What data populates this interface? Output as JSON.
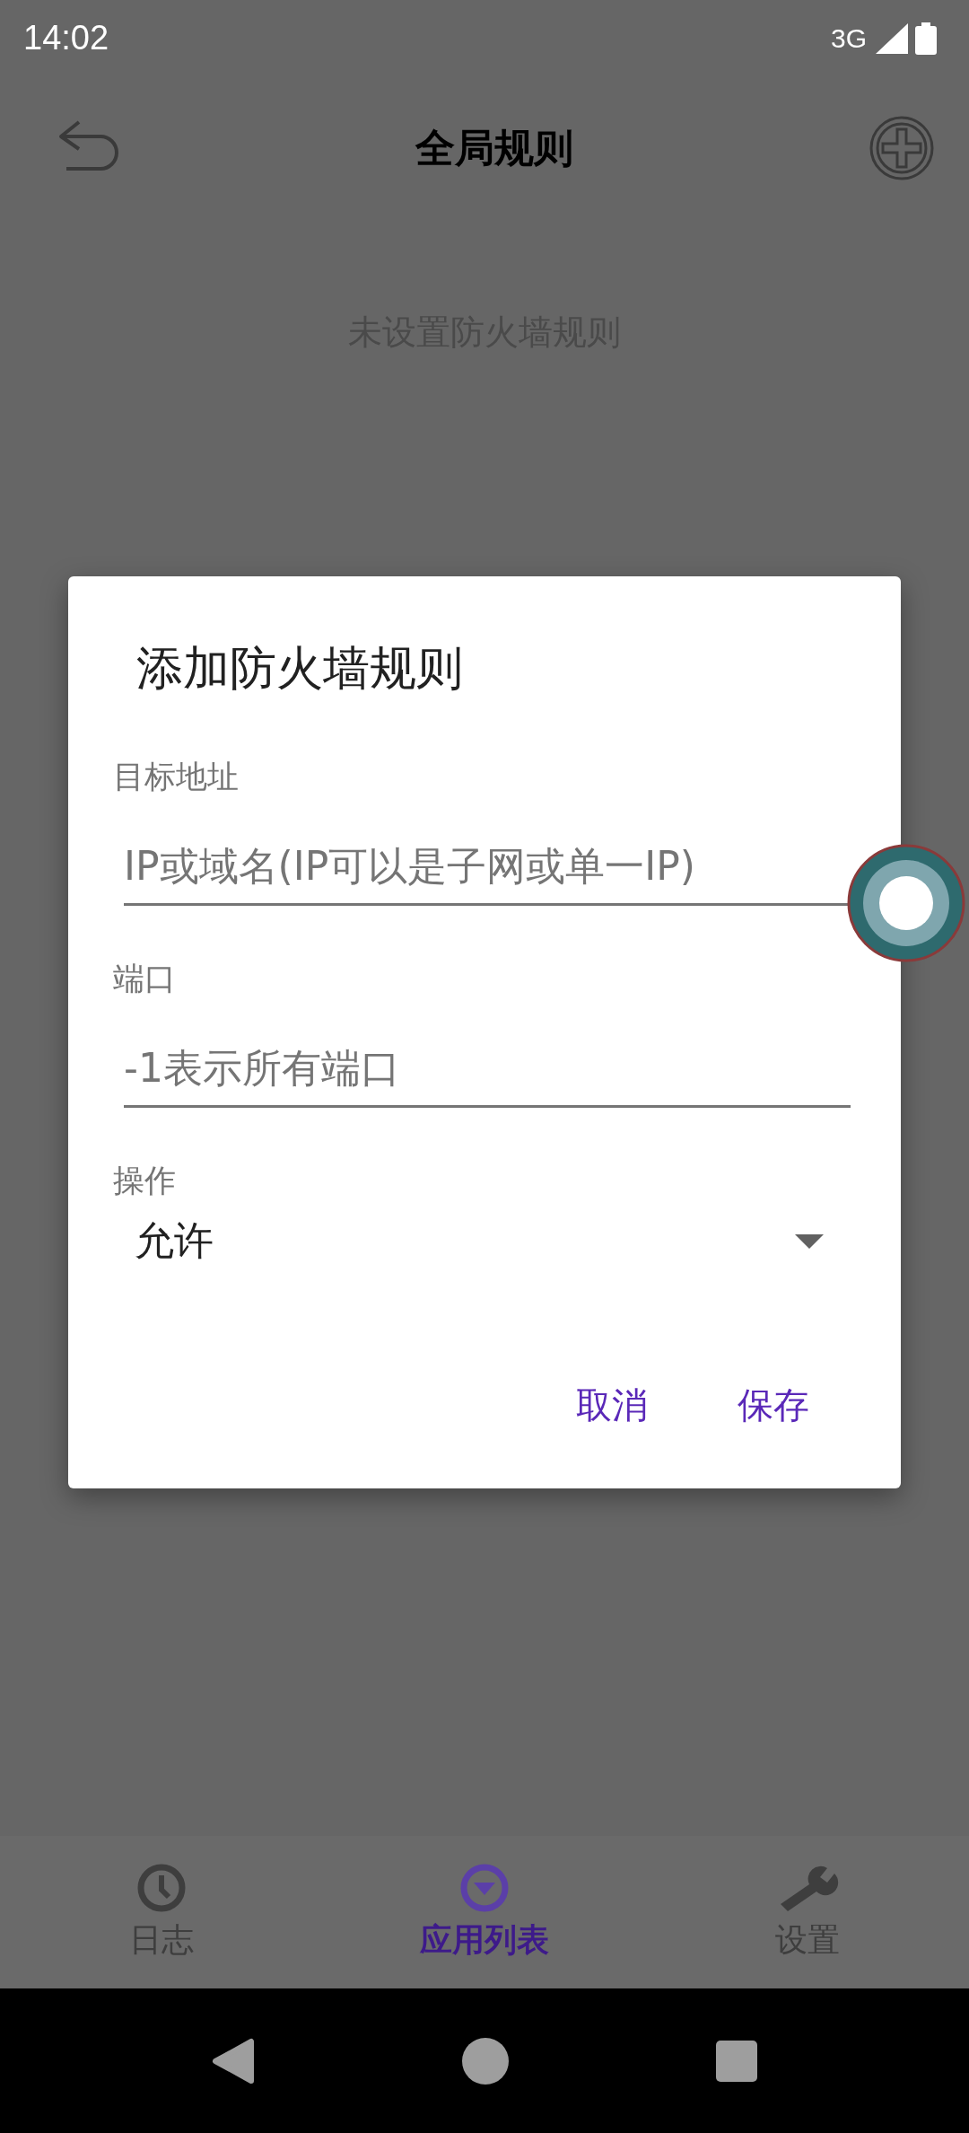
{
  "status_bar": {
    "time": "14:02",
    "network": "3G"
  },
  "header": {
    "title": "全局规则"
  },
  "empty_message": "未设置防火墙规则",
  "dialog": {
    "title": "添加防火墙规则",
    "fields": [
      {
        "label": "目标地址",
        "placeholder": "IP或域名(IP可以是子网或单一IP)"
      },
      {
        "label": "端口",
        "placeholder": "-1表示所有端口"
      }
    ],
    "action": {
      "label": "操作",
      "value": "允许"
    },
    "buttons": [
      "取消",
      "保存"
    ]
  },
  "tabs": [
    {
      "label": "日志",
      "selected": false
    },
    {
      "label": "应用列表",
      "selected": true
    },
    {
      "label": "设置",
      "selected": false
    }
  ]
}
